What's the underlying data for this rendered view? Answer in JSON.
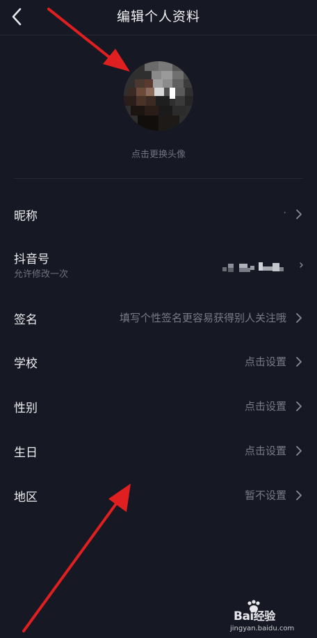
{
  "header": {
    "title": "编辑个人资料",
    "back_icon": "chevron-left-icon"
  },
  "avatar": {
    "change_label": "点击更换头像"
  },
  "fields": {
    "nickname": {
      "label": "昵称",
      "value": "·"
    },
    "douyin_id": {
      "label": "抖音号",
      "hint": "允许修改一次"
    },
    "signature": {
      "label": "签名",
      "value": "填写个性签名更容易获得别人关注哦"
    },
    "school": {
      "label": "学校",
      "value": "点击设置"
    },
    "gender": {
      "label": "性别",
      "value": "点击设置"
    },
    "birthday": {
      "label": "生日",
      "value": "点击设置"
    },
    "region": {
      "label": "地区",
      "value": "暂不设置"
    }
  },
  "watermark": {
    "brand": "Bai",
    "brand_suffix": "经验",
    "url": "jingyan.baidu.com"
  },
  "colors": {
    "background": "#161823",
    "arrow": "#e02020",
    "secondary_text": "#797c88"
  }
}
